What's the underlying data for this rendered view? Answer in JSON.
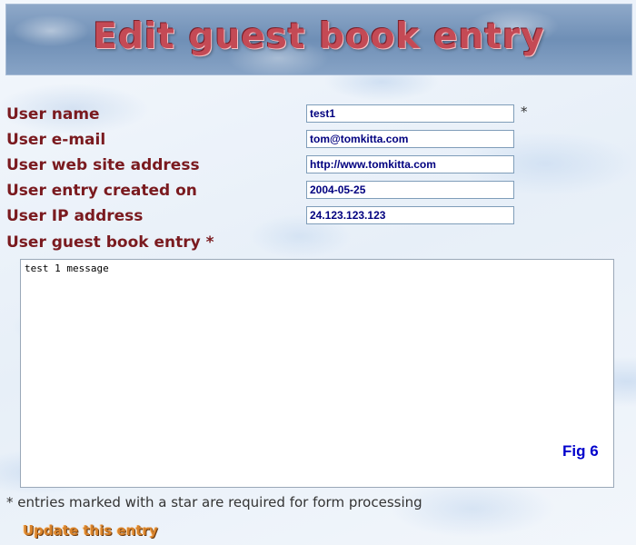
{
  "header": {
    "title": "Edit guest book entry"
  },
  "form": {
    "user_name_label": "User name",
    "user_name_value": "test1",
    "required_star": "*",
    "user_email_label": "User e-mail",
    "user_email_value": "tom@tomkitta.com",
    "user_website_label": "User web site address",
    "user_website_value": "http://www.tomkitta.com",
    "created_on_label": "User entry created on",
    "created_on_value": "2004-05-25",
    "ip_label": "User IP address",
    "ip_value": "24.123.123.123",
    "entry_label": "User guest book entry *",
    "entry_value": "test 1 message",
    "fig_label": "Fig 6",
    "required_note": "* entries marked with a star are required for form processing",
    "update_button": "Update this entry"
  },
  "colors": {
    "label": "#7a1a1f",
    "field_text": "#00007f",
    "banner_text": "#c44a55",
    "fig_text": "#0000cc",
    "button_text": "#d9832b"
  }
}
